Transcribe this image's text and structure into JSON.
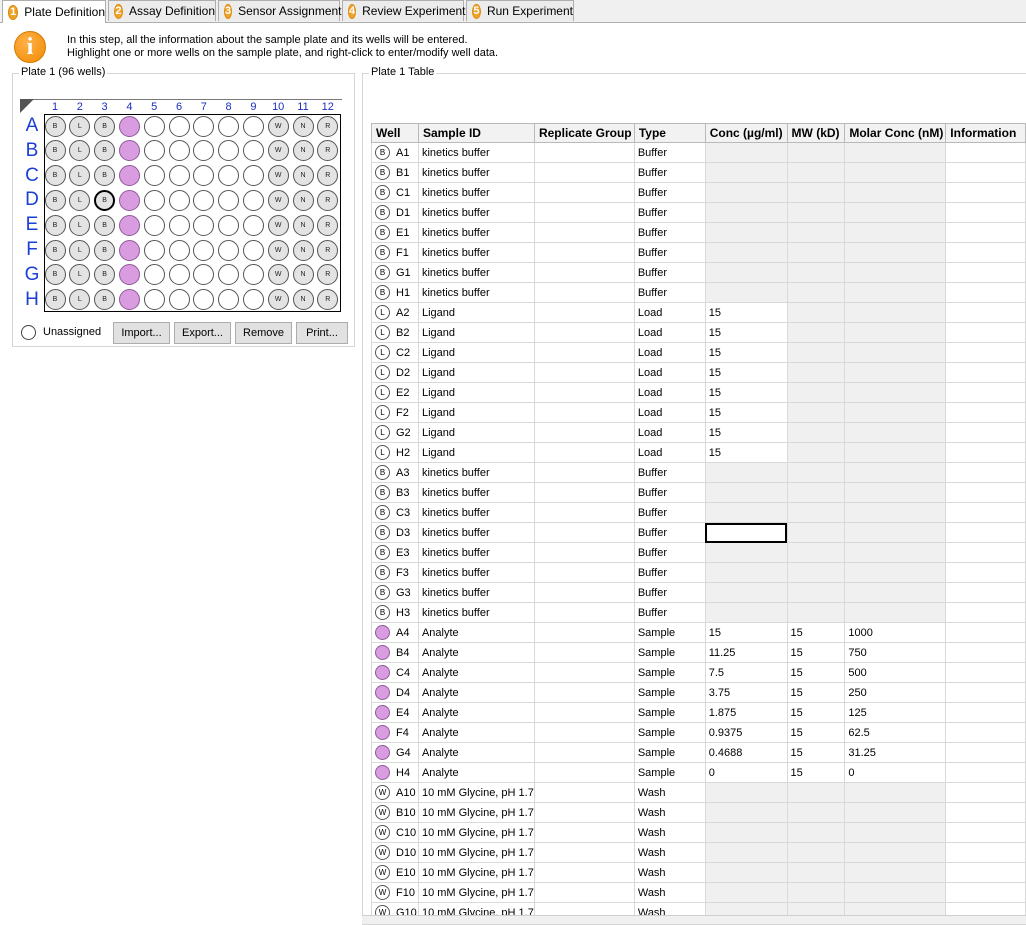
{
  "tabs": [
    {
      "num": "1",
      "label": "Plate Definition"
    },
    {
      "num": "2",
      "label": "Assay Definition"
    },
    {
      "num": "3",
      "label": "Sensor Assignment"
    },
    {
      "num": "4",
      "label": "Review Experiment"
    },
    {
      "num": "5",
      "label": "Run Experiment"
    }
  ],
  "info": {
    "line1": "In this step, all the information about the sample plate and its wells will be entered.",
    "line2": "Highlight one or more wells on the sample plate, and right-click to enter/modify well data."
  },
  "plate_panel": {
    "title": "Plate 1 (96 wells)",
    "columns": [
      "1",
      "2",
      "3",
      "4",
      "5",
      "6",
      "7",
      "8",
      "9",
      "10",
      "11",
      "12"
    ],
    "rows": [
      "A",
      "B",
      "C",
      "D",
      "E",
      "F",
      "G",
      "H"
    ],
    "well_marks": [
      "B",
      "L",
      "B",
      "S",
      "",
      "",
      "",
      "",
      "",
      "W",
      "N",
      "R"
    ],
    "selected_well": "D3",
    "unassigned_label": "Unassigned",
    "buttons": {
      "import": "Import...",
      "export": "Export...",
      "remove": "Remove",
      "print": "Print..."
    }
  },
  "table_panel": {
    "title": "Plate 1 Table",
    "headers": [
      "Well",
      "Sample ID",
      "Replicate Group",
      "Type",
      "Conc (µg/ml)",
      "MW (kD)",
      "Molar Conc (nM)",
      "Information"
    ],
    "focused_row": "D3",
    "rows": [
      {
        "icon": "B",
        "well": "A1",
        "sample": "kinetics buffer",
        "rep": "",
        "type": "Buffer",
        "conc": "",
        "mw": "",
        "molar": "",
        "info": ""
      },
      {
        "icon": "B",
        "well": "B1",
        "sample": "kinetics buffer",
        "rep": "",
        "type": "Buffer",
        "conc": "",
        "mw": "",
        "molar": "",
        "info": ""
      },
      {
        "icon": "B",
        "well": "C1",
        "sample": "kinetics buffer",
        "rep": "",
        "type": "Buffer",
        "conc": "",
        "mw": "",
        "molar": "",
        "info": ""
      },
      {
        "icon": "B",
        "well": "D1",
        "sample": "kinetics buffer",
        "rep": "",
        "type": "Buffer",
        "conc": "",
        "mw": "",
        "molar": "",
        "info": ""
      },
      {
        "icon": "B",
        "well": "E1",
        "sample": "kinetics buffer",
        "rep": "",
        "type": "Buffer",
        "conc": "",
        "mw": "",
        "molar": "",
        "info": ""
      },
      {
        "icon": "B",
        "well": "F1",
        "sample": "kinetics buffer",
        "rep": "",
        "type": "Buffer",
        "conc": "",
        "mw": "",
        "molar": "",
        "info": ""
      },
      {
        "icon": "B",
        "well": "G1",
        "sample": "kinetics buffer",
        "rep": "",
        "type": "Buffer",
        "conc": "",
        "mw": "",
        "molar": "",
        "info": ""
      },
      {
        "icon": "B",
        "well": "H1",
        "sample": "kinetics buffer",
        "rep": "",
        "type": "Buffer",
        "conc": "",
        "mw": "",
        "molar": "",
        "info": ""
      },
      {
        "icon": "L",
        "well": "A2",
        "sample": "Ligand",
        "rep": "",
        "type": "Load",
        "conc": "15",
        "mw": "",
        "molar": "",
        "info": ""
      },
      {
        "icon": "L",
        "well": "B2",
        "sample": "Ligand",
        "rep": "",
        "type": "Load",
        "conc": "15",
        "mw": "",
        "molar": "",
        "info": ""
      },
      {
        "icon": "L",
        "well": "C2",
        "sample": "Ligand",
        "rep": "",
        "type": "Load",
        "conc": "15",
        "mw": "",
        "molar": "",
        "info": ""
      },
      {
        "icon": "L",
        "well": "D2",
        "sample": "Ligand",
        "rep": "",
        "type": "Load",
        "conc": "15",
        "mw": "",
        "molar": "",
        "info": ""
      },
      {
        "icon": "L",
        "well": "E2",
        "sample": "Ligand",
        "rep": "",
        "type": "Load",
        "conc": "15",
        "mw": "",
        "molar": "",
        "info": ""
      },
      {
        "icon": "L",
        "well": "F2",
        "sample": "Ligand",
        "rep": "",
        "type": "Load",
        "conc": "15",
        "mw": "",
        "molar": "",
        "info": ""
      },
      {
        "icon": "L",
        "well": "G2",
        "sample": "Ligand",
        "rep": "",
        "type": "Load",
        "conc": "15",
        "mw": "",
        "molar": "",
        "info": ""
      },
      {
        "icon": "L",
        "well": "H2",
        "sample": "Ligand",
        "rep": "",
        "type": "Load",
        "conc": "15",
        "mw": "",
        "molar": "",
        "info": ""
      },
      {
        "icon": "B",
        "well": "A3",
        "sample": "kinetics buffer",
        "rep": "",
        "type": "Buffer",
        "conc": "",
        "mw": "",
        "molar": "",
        "info": ""
      },
      {
        "icon": "B",
        "well": "B3",
        "sample": "kinetics buffer",
        "rep": "",
        "type": "Buffer",
        "conc": "",
        "mw": "",
        "molar": "",
        "info": ""
      },
      {
        "icon": "B",
        "well": "C3",
        "sample": "kinetics buffer",
        "rep": "",
        "type": "Buffer",
        "conc": "",
        "mw": "",
        "molar": "",
        "info": ""
      },
      {
        "icon": "B",
        "well": "D3",
        "sample": "kinetics buffer",
        "rep": "",
        "type": "Buffer",
        "conc": "",
        "mw": "",
        "molar": "",
        "info": ""
      },
      {
        "icon": "B",
        "well": "E3",
        "sample": "kinetics buffer",
        "rep": "",
        "type": "Buffer",
        "conc": "",
        "mw": "",
        "molar": "",
        "info": ""
      },
      {
        "icon": "B",
        "well": "F3",
        "sample": "kinetics buffer",
        "rep": "",
        "type": "Buffer",
        "conc": "",
        "mw": "",
        "molar": "",
        "info": ""
      },
      {
        "icon": "B",
        "well": "G3",
        "sample": "kinetics buffer",
        "rep": "",
        "type": "Buffer",
        "conc": "",
        "mw": "",
        "molar": "",
        "info": ""
      },
      {
        "icon": "B",
        "well": "H3",
        "sample": "kinetics buffer",
        "rep": "",
        "type": "Buffer",
        "conc": "",
        "mw": "",
        "molar": "",
        "info": ""
      },
      {
        "icon": "S",
        "well": "A4",
        "sample": "Analyte",
        "rep": "",
        "type": "Sample",
        "conc": "15",
        "mw": "15",
        "molar": "1000",
        "info": ""
      },
      {
        "icon": "S",
        "well": "B4",
        "sample": "Analyte",
        "rep": "",
        "type": "Sample",
        "conc": "11.25",
        "mw": "15",
        "molar": "750",
        "info": ""
      },
      {
        "icon": "S",
        "well": "C4",
        "sample": "Analyte",
        "rep": "",
        "type": "Sample",
        "conc": "7.5",
        "mw": "15",
        "molar": "500",
        "info": ""
      },
      {
        "icon": "S",
        "well": "D4",
        "sample": "Analyte",
        "rep": "",
        "type": "Sample",
        "conc": "3.75",
        "mw": "15",
        "molar": "250",
        "info": ""
      },
      {
        "icon": "S",
        "well": "E4",
        "sample": "Analyte",
        "rep": "",
        "type": "Sample",
        "conc": "1.875",
        "mw": "15",
        "molar": "125",
        "info": ""
      },
      {
        "icon": "S",
        "well": "F4",
        "sample": "Analyte",
        "rep": "",
        "type": "Sample",
        "conc": "0.9375",
        "mw": "15",
        "molar": "62.5",
        "info": ""
      },
      {
        "icon": "S",
        "well": "G4",
        "sample": "Analyte",
        "rep": "",
        "type": "Sample",
        "conc": "0.4688",
        "mw": "15",
        "molar": "31.25",
        "info": ""
      },
      {
        "icon": "S",
        "well": "H4",
        "sample": "Analyte",
        "rep": "",
        "type": "Sample",
        "conc": "0",
        "mw": "15",
        "molar": "0",
        "info": ""
      },
      {
        "icon": "W",
        "well": "A10",
        "sample": "10 mM Glycine, pH 1.7",
        "rep": "",
        "type": "Wash",
        "conc": "",
        "mw": "",
        "molar": "",
        "info": ""
      },
      {
        "icon": "W",
        "well": "B10",
        "sample": "10 mM Glycine, pH 1.7",
        "rep": "",
        "type": "Wash",
        "conc": "",
        "mw": "",
        "molar": "",
        "info": ""
      },
      {
        "icon": "W",
        "well": "C10",
        "sample": "10 mM Glycine, pH 1.7",
        "rep": "",
        "type": "Wash",
        "conc": "",
        "mw": "",
        "molar": "",
        "info": ""
      },
      {
        "icon": "W",
        "well": "D10",
        "sample": "10 mM Glycine, pH 1.7",
        "rep": "",
        "type": "Wash",
        "conc": "",
        "mw": "",
        "molar": "",
        "info": ""
      },
      {
        "icon": "W",
        "well": "E10",
        "sample": "10 mM Glycine, pH 1.7",
        "rep": "",
        "type": "Wash",
        "conc": "",
        "mw": "",
        "molar": "",
        "info": ""
      },
      {
        "icon": "W",
        "well": "F10",
        "sample": "10 mM Glycine, pH 1.7",
        "rep": "",
        "type": "Wash",
        "conc": "",
        "mw": "",
        "molar": "",
        "info": ""
      },
      {
        "icon": "W",
        "well": "G10",
        "sample": "10 mM Glycine, pH 1.7",
        "rep": "",
        "type": "Wash",
        "conc": "",
        "mw": "",
        "molar": "",
        "info": ""
      }
    ]
  }
}
